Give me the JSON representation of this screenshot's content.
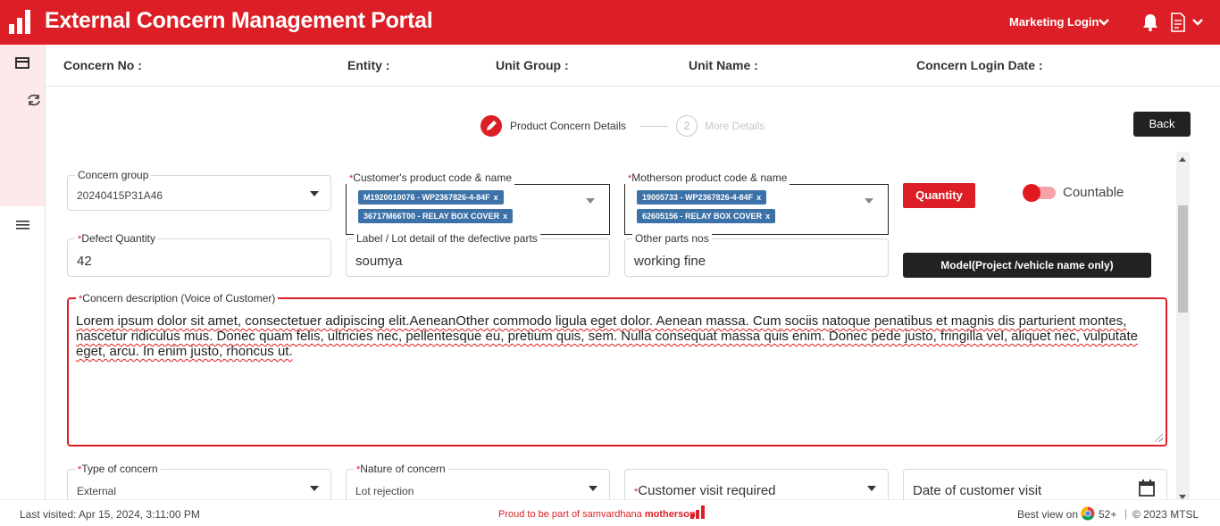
{
  "header": {
    "title": "External Concern Management Portal",
    "login_label": "Marketing Login",
    "accent_color": "#dc1f26"
  },
  "info_bar": {
    "concern_no": "Concern No :",
    "entity": "Entity :",
    "unit_group": "Unit Group :",
    "unit_name": "Unit Name :",
    "login_date": "Concern Login Date :"
  },
  "stepper": {
    "step1_label": "Product Concern Details",
    "step2_number": "2",
    "step2_label": "More Details"
  },
  "back_label": "Back",
  "form": {
    "concern_group": {
      "label": "Concern group",
      "value": "20240415P31A46"
    },
    "customer_product": {
      "label": "Customer's product code & name",
      "required_mark": "*",
      "chips": [
        "M1920010076 - WP2367826-4-84F",
        "36717M66T00 - RELAY BOX COVER"
      ]
    },
    "motherson_product": {
      "label": "Motherson product code & name",
      "required_mark": "*",
      "chips": [
        "19005733 - WP2367826-4-84F",
        "62605156 - RELAY BOX COVER"
      ]
    },
    "quantity_label": "Quantity",
    "countable_label": "Countable",
    "defect_quantity": {
      "label": "Defect Quantity",
      "required_mark": "*",
      "value": "42"
    },
    "lot_detail": {
      "label": "Label / Lot detail of the defective parts",
      "value": "soumya"
    },
    "other_parts": {
      "label": "Other parts nos",
      "value": "working fine"
    },
    "model_label": "Model(Project /vehicle name only)",
    "description": {
      "label": "Concern description (Voice of Customer)",
      "required_mark": "*",
      "value": "Lorem ipsum dolor sit amet, consectetuer adipiscing elit.AeneanOther commodo ligula eget dolor. Aenean massa. Cum sociis natoque penatibus et magnis dis parturient montes, nascetur ridiculus mus. Donec quam felis, ultricies nec, pellentesque eu, pretium quis, sem. Nulla consequat massa quis enim. Donec pede justo, fringilla vel, aliquet nec, vulputate eget, arcu. In enim justo, rhoncus ut."
    },
    "type_of_concern": {
      "label": "Type of concern",
      "required_mark": "*",
      "value": "External"
    },
    "nature_of_concern": {
      "label": "Nature of concern",
      "required_mark": "*",
      "value": "Lot rejection"
    },
    "customer_visit": {
      "label": "Customer visit required",
      "required_mark": "*"
    },
    "visit_date": {
      "placeholder": "Date of customer visit"
    }
  },
  "footer": {
    "last_visited": "Last visited: Apr 15, 2024, 3:11:00 PM",
    "proud_text": "Proud to be part of samvardhana",
    "brand": "motherson",
    "best_view": "Best view on",
    "browser_version": "52+",
    "separator": "|",
    "copyright": "© 2023 MTSL"
  },
  "icons": [
    "logo-icon",
    "chevron-down-icon",
    "bell-icon",
    "document-icon",
    "card-icon",
    "sync-icon",
    "menu-icon",
    "pencil-icon",
    "calendar-icon",
    "chrome-icon"
  ]
}
